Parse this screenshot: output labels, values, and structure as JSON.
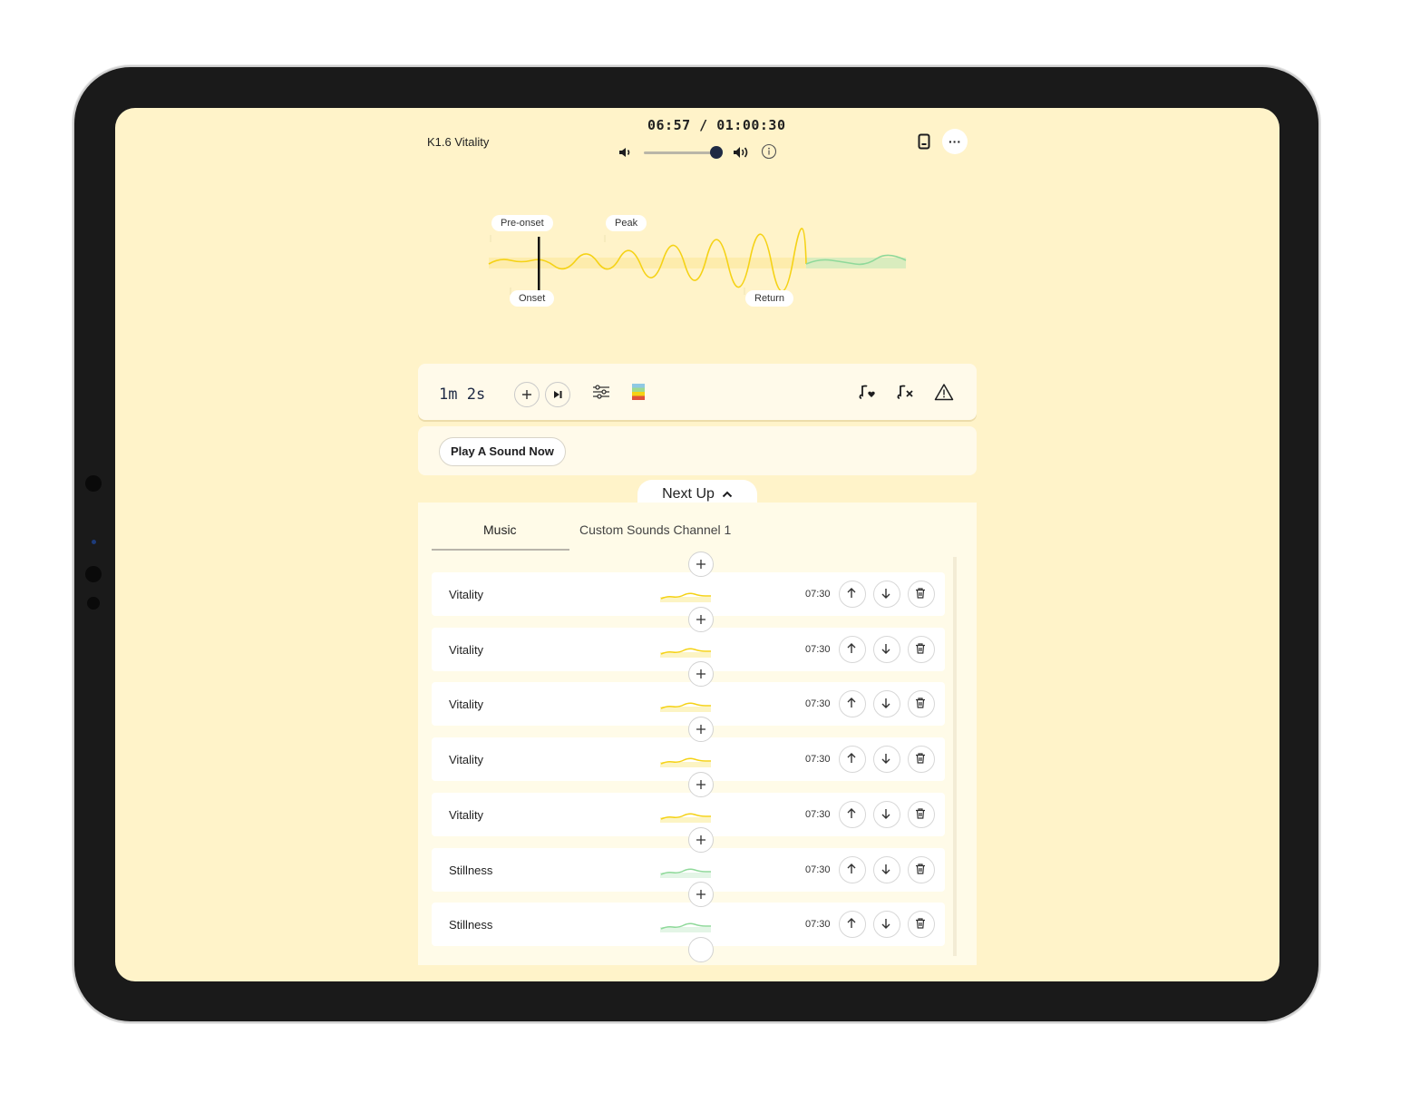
{
  "header": {
    "title": "K1.6 Vitality",
    "clock": "06:57 / 01:00:30",
    "volume_level": 0.98,
    "more_label": "···"
  },
  "timeline": {
    "markers_top": [
      "Pre-onset",
      "Peak"
    ],
    "markers_bottom": [
      "Onset",
      "Return"
    ],
    "colors": {
      "vitality": "#f5d215",
      "stillness": "#8fd99a"
    }
  },
  "controls": {
    "timer": "1m 2s",
    "play_sound_label": "Play A Sound Now",
    "next_up_label": "Next Up"
  },
  "tabs": [
    {
      "label": "Music",
      "active": true
    },
    {
      "label": "Custom Sounds Channel 1",
      "active": false
    }
  ],
  "queue": [
    {
      "name": "Vitality",
      "duration": "07:30",
      "color": "#f5d215"
    },
    {
      "name": "Vitality",
      "duration": "07:30",
      "color": "#f5d215"
    },
    {
      "name": "Vitality",
      "duration": "07:30",
      "color": "#f5d215"
    },
    {
      "name": "Vitality",
      "duration": "07:30",
      "color": "#f5d215"
    },
    {
      "name": "Vitality",
      "duration": "07:30",
      "color": "#f5d215"
    },
    {
      "name": "Stillness",
      "duration": "07:30",
      "color": "#8fd99a"
    },
    {
      "name": "Stillness",
      "duration": "07:30",
      "color": "#8fd99a"
    }
  ],
  "icons": {
    "volume_down": "speaker-low-icon",
    "volume_up": "speaker-high-icon",
    "info": "info-icon",
    "device": "phone-icon",
    "add": "plus-icon",
    "skip": "skip-icon",
    "settings": "sliders-icon",
    "palette": "color-bars-icon",
    "favorite": "music-heart-icon",
    "remove_music": "music-x-icon",
    "warning": "warning-icon",
    "move_up": "arrow-up-icon",
    "move_down": "arrow-down-icon",
    "delete": "trash-icon"
  }
}
